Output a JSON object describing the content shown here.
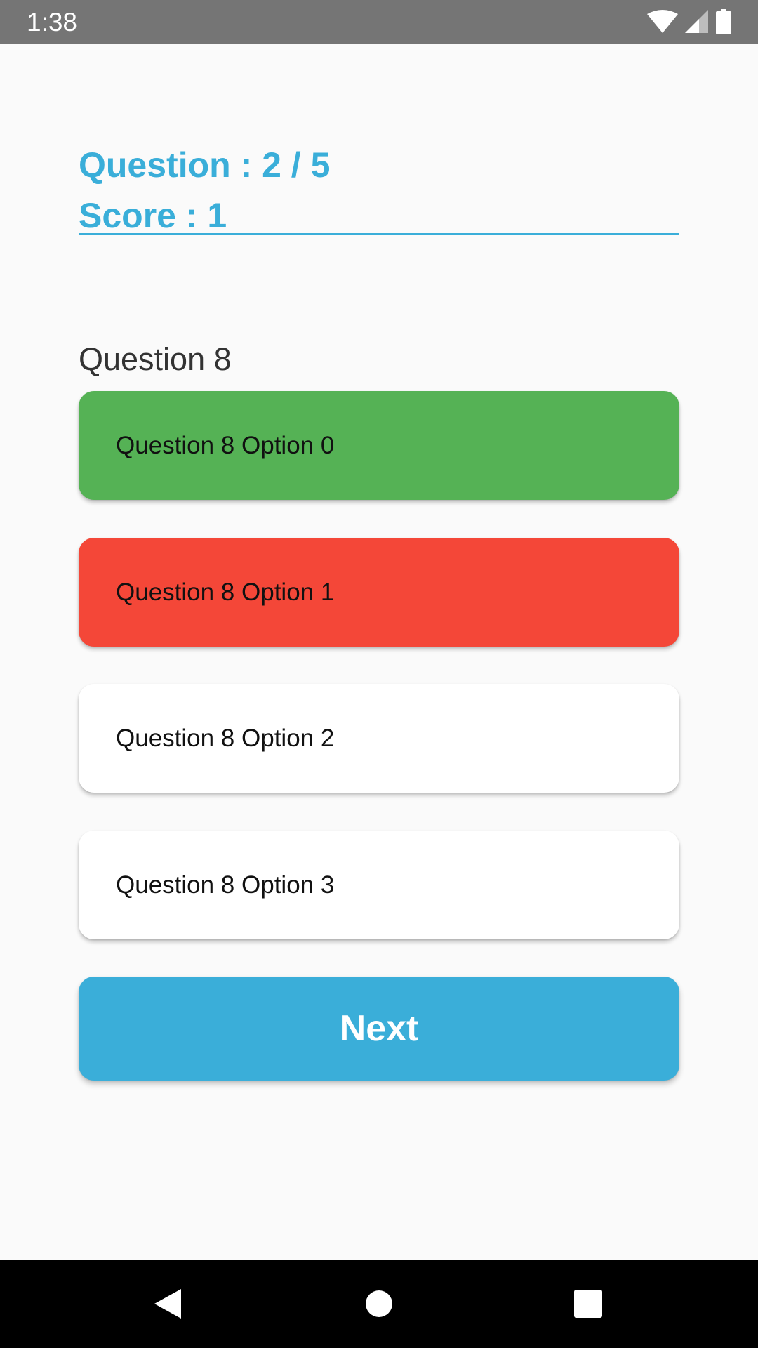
{
  "status_bar": {
    "time": "1:38",
    "icons": [
      "wifi-icon",
      "signal-icon",
      "battery-icon"
    ]
  },
  "quiz": {
    "progress": "Question : 2 / 5",
    "score": "Score : 1",
    "question": "Question 8",
    "options": [
      {
        "label": "Question 8 Option 0",
        "state": "correct",
        "color": "#55b255"
      },
      {
        "label": "Question 8 Option 1",
        "state": "wrong",
        "color": "#f44738"
      },
      {
        "label": "Question 8 Option 2",
        "state": "neutral",
        "color": "#ffffff"
      },
      {
        "label": "Question 8 Option 3",
        "state": "neutral",
        "color": "#ffffff"
      }
    ],
    "next_label": "Next"
  },
  "colors": {
    "accent": "#3aaed9",
    "correct": "#55b255",
    "wrong": "#f44738",
    "status_bar": "#757575",
    "nav_bar": "#000000",
    "background": "#fafafa"
  },
  "nav_bar": {
    "icons": [
      "back-icon",
      "home-icon",
      "recents-icon"
    ]
  }
}
